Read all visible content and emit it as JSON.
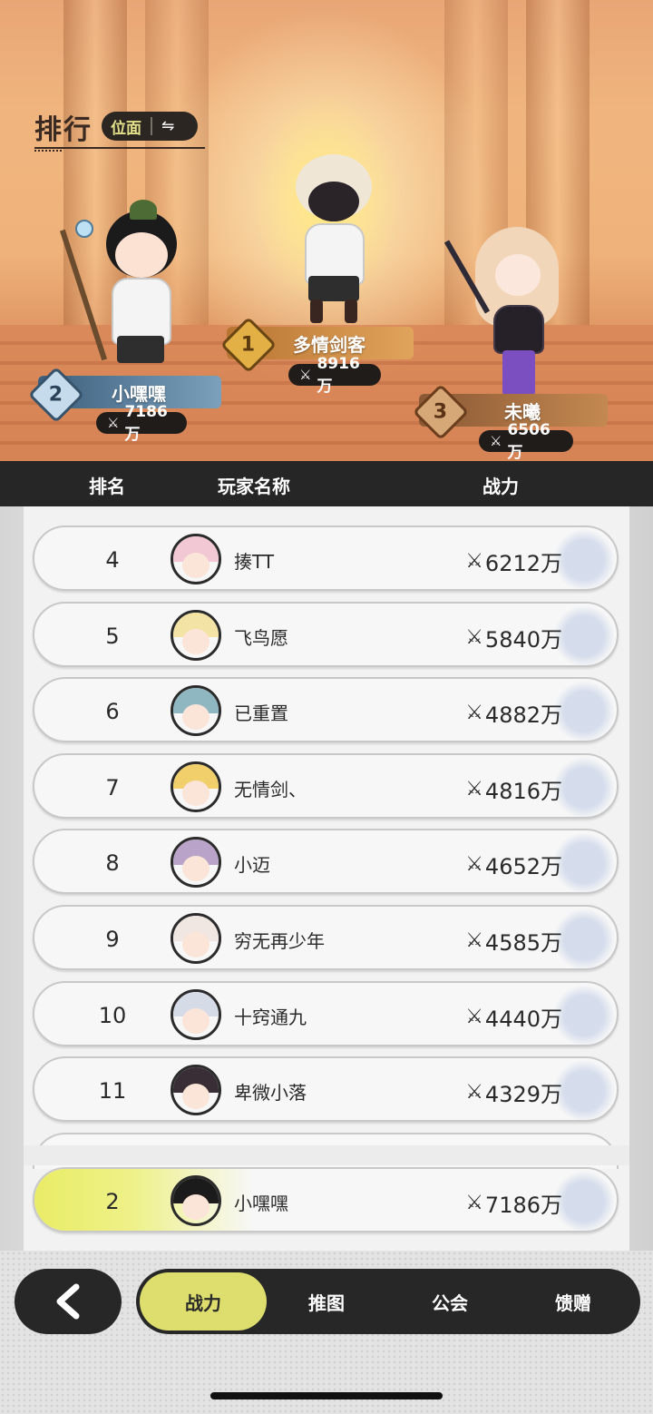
{
  "header": {
    "title": "排行",
    "switch_label": "位面",
    "switch_icon": "swap-arrows-icon"
  },
  "podium": {
    "first": {
      "rank": "1",
      "name": "多情剑客",
      "power": "8916万"
    },
    "second": {
      "rank": "2",
      "name": "小嘿嘿",
      "power": "7186万"
    },
    "third": {
      "rank": "3",
      "name": "未曦",
      "power": "6506万"
    },
    "power_icon": "crossed-swords-icon"
  },
  "columns": {
    "rank": "排名",
    "player": "玩家名称",
    "power": "战力"
  },
  "rows": [
    {
      "rank": "4",
      "name": "揍TT",
      "power": "6212万",
      "hair": "#f2c8d4"
    },
    {
      "rank": "5",
      "name": "飞鸟愿",
      "power": "5840万",
      "hair": "#f3e3a4"
    },
    {
      "rank": "6",
      "name": "已重置",
      "power": "4882万",
      "hair": "#8fb7c2"
    },
    {
      "rank": "7",
      "name": "无情剑、",
      "power": "4816万",
      "hair": "#f1cf6a"
    },
    {
      "rank": "8",
      "name": "小迈",
      "power": "4652万",
      "hair": "#b9a3c9"
    },
    {
      "rank": "9",
      "name": "穷无再少年",
      "power": "4585万",
      "hair": "#f1e7e2"
    },
    {
      "rank": "10",
      "name": "十窍通九",
      "power": "4440万",
      "hair": "#d6dbe8"
    },
    {
      "rank": "11",
      "name": "卑微小落",
      "power": "4329万",
      "hair": "#3a2e36"
    }
  ],
  "self": {
    "rank": "2",
    "name": "小嘿嘿",
    "power": "7186万"
  },
  "bottom_nav": {
    "back_icon": "chevron-left-icon",
    "tabs": [
      "战力",
      "推图",
      "公会",
      "馈赠"
    ],
    "active_tab": "战力"
  },
  "colors": {
    "dark": "#262626",
    "accent_yellow": "#dede6e",
    "row_bg": "#f7f7f7"
  }
}
